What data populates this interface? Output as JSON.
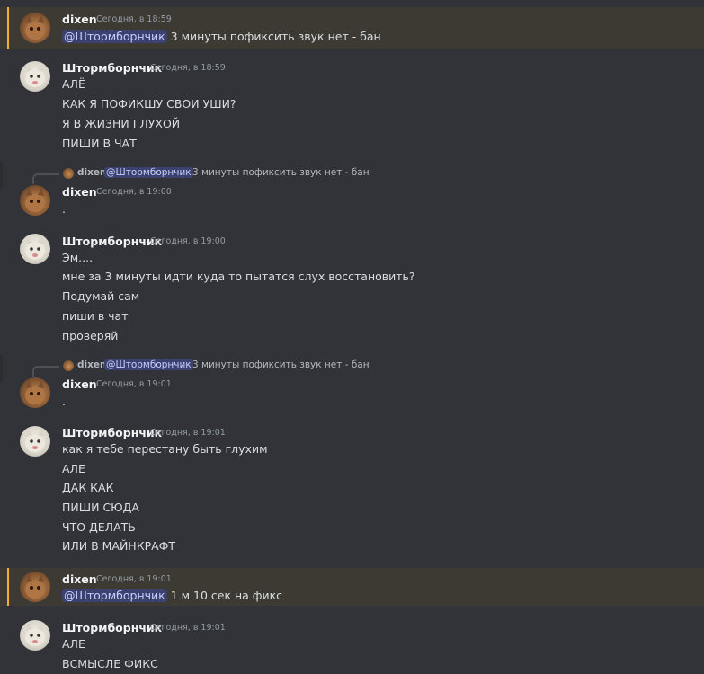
{
  "theme": {
    "background": "#313338",
    "highlight_background": "#3d3a33",
    "highlight_bar": "#f0b232",
    "mention_background": "#3c4270",
    "mention_text": "#c9cdfb"
  },
  "messages": [
    {
      "author": "dixen",
      "time": "Сегодня, в 18:59",
      "highlighted": true,
      "mention": "@Штормборнчик",
      "lines": [
        "3 минуты пофиксить звук нет - бан"
      ]
    },
    {
      "author": "Штормборнчик",
      "time": "Сегодня, в 18:59",
      "lines": [
        "АЛЁ",
        "КАК Я ПОФИКШУ СВОИ УШИ?",
        "Я В ЖИЗНИ ГЛУХОЙ",
        "ПИШИ В ЧАТ"
      ]
    },
    {
      "reply": {
        "author": "dixen",
        "mention": "@Штормборнчик",
        "text": "3 минуты пофиксить звук нет - бан"
      },
      "author": "dixen",
      "time": "Сегодня, в 19:00",
      "lines": [
        "."
      ]
    },
    {
      "author": "Штормборнчик",
      "time": "Сегодня, в 19:00",
      "lines": [
        "Эм....",
        "мне за 3 минуты идти куда то пытатся слух восстановить?",
        "Подумай сам",
        "пиши в чат",
        "проверяй"
      ]
    },
    {
      "reply": {
        "author": "dixen",
        "mention": "@Штормборнчик",
        "text": "3 минуты пофиксить звук нет - бан"
      },
      "author": "dixen",
      "time": "Сегодня, в 19:01",
      "lines": [
        "."
      ]
    },
    {
      "author": "Штормборнчик",
      "time": "Сегодня, в 19:01",
      "lines": [
        "как я тебе перестану быть глухим",
        "АЛЕ",
        "ДАК КАК",
        "ПИШИ СЮДА",
        "ЧТО ДЕЛАТЬ",
        "ИЛИ В МАЙНКРАФТ"
      ]
    },
    {
      "author": "dixen",
      "time": "Сегодня, в 19:01",
      "highlighted": true,
      "mention": "@Штормборнчик",
      "lines": [
        "1 м 10 сек на фикс"
      ]
    },
    {
      "author": "Штормборнчик",
      "time": "Сегодня, в 19:01",
      "lines": [
        "АЛЕ",
        "ВСМЫСЛЕ ФИКС"
      ]
    }
  ]
}
